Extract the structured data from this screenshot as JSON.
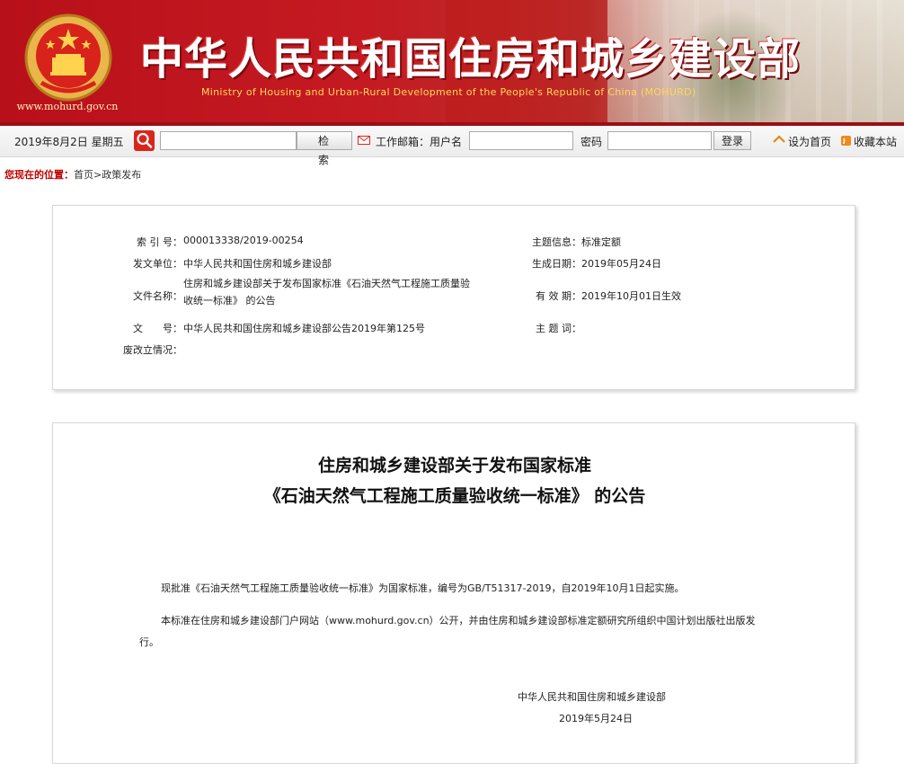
{
  "banner": {
    "title_cn": "中华人民共和国住房和城乡建设部",
    "title_en": "Ministry of Housing and Urban-Rural Development of the People's Republic of China (MOHURD)",
    "site_url": "www.mohurd.gov.cn"
  },
  "toolbar": {
    "date": "2019年8月2日 星期五",
    "search_label": "检 索",
    "mail_label": "工作邮箱：用户名",
    "password_label": "密码",
    "login_label": "登录",
    "set_home_label": "设为首页",
    "bookmark_label": "收藏本站"
  },
  "breadcrumb": {
    "prefix": "您现在的位置：",
    "path": "首页>政策发布"
  },
  "meta": {
    "index_label": "索 引 号：",
    "index_value": "000013338/2019-00254",
    "issuer_label": "发文单位：",
    "issuer_value": "中华人民共和国住房和城乡建设部",
    "docname_label": "文件名称：",
    "docname_value": "住房和城乡建设部关于发布国家标准《石油天然气工程施工质量验收统一标准》 的公告",
    "docno_label": "文　　号：",
    "docno_value": "中华人民共和国住房和城乡建设部公告2019年第125号",
    "revision_label": "废改立情况：",
    "revision_value": "",
    "topic_label": "主题信息：",
    "topic_value": "标准定额",
    "created_label": "生成日期：",
    "created_value": "2019年05月24日",
    "valid_label": "有 效 期：",
    "valid_value": "2019年10月01日生效",
    "keyword_label": "主 题 词：",
    "keyword_value": ""
  },
  "article": {
    "title_line1": "住房和城乡建设部关于发布国家标准",
    "title_line2": "《石油天然气工程施工质量验收统一标准》 的公告",
    "para1": "现批准《石油天然气工程施工质量验收统一标准》为国家标准，编号为GB/T51317-2019，自2019年10月1日起实施。",
    "para2": "本标准在住房和城乡建设部门户网站（www.mohurd.gov.cn）公开，并由住房和城乡建设部标准定额研究所组织中国计划出版社出版发行。",
    "signature": "中华人民共和国住房和城乡建设部",
    "sign_date": "2019年5月24日"
  },
  "colors": {
    "banner_red": "#c51a22",
    "title_en_gold": "#ffd75a",
    "breadcrumb_red": "#c00000"
  }
}
